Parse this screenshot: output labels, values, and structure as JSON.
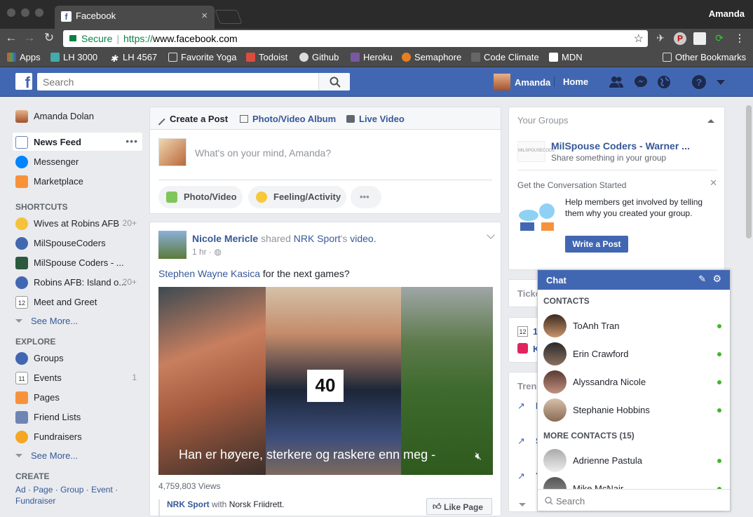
{
  "browser": {
    "tab_title": "Facebook",
    "user": "Amanda",
    "url_secure": "Secure",
    "url_scheme": "https://",
    "url_host": "www.facebook.com",
    "bookmarks": [
      "Apps",
      "LH 3000",
      "LH 4567",
      "Favorite Yoga",
      "Todoist",
      "Github",
      "Heroku",
      "Semaphore",
      "Code Climate",
      "MDN"
    ],
    "other_bookmarks": "Other Bookmarks"
  },
  "fb": {
    "search_placeholder": "Search",
    "profile_name": "Amanda",
    "home": "Home",
    "brand_color": "#4267b2"
  },
  "left_nav": {
    "user": "Amanda Dolan",
    "news_feed": "News Feed",
    "messenger": "Messenger",
    "marketplace": "Marketplace",
    "shortcuts_heading": "SHORTCUTS",
    "shortcuts": [
      {
        "label": "Wives at Robins AFB",
        "count": "20+"
      },
      {
        "label": "MilSpouseCoders",
        "count": ""
      },
      {
        "label": "MilSpouse Coders - ...",
        "count": ""
      },
      {
        "label": "Robins AFB: Island o...",
        "count": "20+"
      },
      {
        "label": "Meet and Greet",
        "count": ""
      }
    ],
    "see_more": "See More...",
    "explore_heading": "EXPLORE",
    "explore": [
      {
        "label": "Groups",
        "count": ""
      },
      {
        "label": "Events",
        "count": "1"
      },
      {
        "label": "Pages",
        "count": ""
      },
      {
        "label": "Friend Lists",
        "count": ""
      },
      {
        "label": "Fundraisers",
        "count": ""
      }
    ],
    "create_heading": "CREATE",
    "create_links": [
      "Ad",
      "Page",
      "Group",
      "Event",
      "Fundraiser"
    ]
  },
  "composer": {
    "tab_create": "Create a Post",
    "tab_album": "Photo/Video Album",
    "tab_live": "Live Video",
    "placeholder": "What's on your mind, Amanda?",
    "photo_video": "Photo/Video",
    "feeling": "Feeling/Activity",
    "more": "•••"
  },
  "post": {
    "author": "Nicole Mericle",
    "shared": "shared",
    "page": "NRK Sport",
    "possessive": "'s",
    "video_word": "video.",
    "time": "1 hr · ",
    "mention": "Stephen Wayne Kasica",
    "text": " for the next games?",
    "bib": "40",
    "caption": "Han er høyere, sterkere og raskere enn meg -",
    "views": "4,759,803 Views",
    "source_page": "NRK Sport",
    "with": "with",
    "with_page": "Norsk Friidrett.",
    "like_page": "Like Page"
  },
  "right": {
    "groups_title": "Your Groups",
    "group_name": "MilSpouse Coders - Warner ...",
    "group_sub": "Share something in your group",
    "group_logo": "MILSPOUSECODE",
    "conv_title": "Get the Conversation Started",
    "conv_text": "Help members get involved by telling them why you created your group.",
    "write_post": "Write a Post",
    "tickets": "Ticke",
    "events_day": "12",
    "events_line1": "1",
    "events_line2": "K",
    "trending": "Tren",
    "trend_items": [
      "F",
      "S",
      "Y"
    ]
  },
  "chat": {
    "title": "Chat",
    "contacts_heading": "CONTACTS",
    "more_heading": "MORE CONTACTS (15)",
    "contacts": [
      "ToAnh Tran",
      "Erin Crawford",
      "Alyssandra Nicole",
      "Stephanie Hobbins"
    ],
    "more_contacts": [
      "Adrienne Pastula",
      "Mike McNair"
    ],
    "search_placeholder": "Search"
  }
}
